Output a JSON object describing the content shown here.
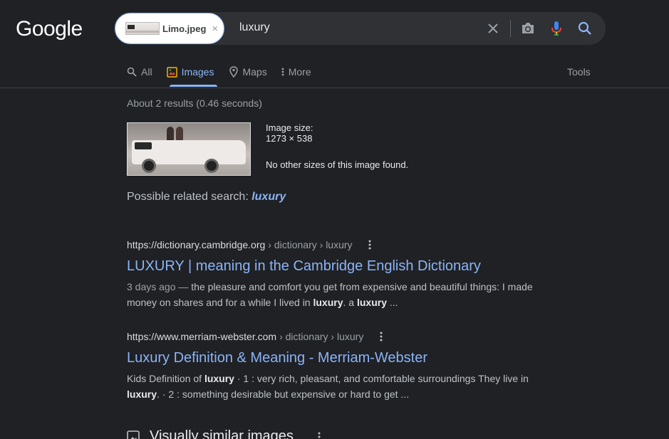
{
  "header": {
    "logo": "Google",
    "chip_label": "Limo.jpeg",
    "chip_close": "×",
    "query": "luxury"
  },
  "tabs": [
    {
      "label": "All",
      "icon": "search-icon"
    },
    {
      "label": "Images",
      "icon": "image-icon",
      "active": true
    },
    {
      "label": "Maps",
      "icon": "map-pin-icon"
    },
    {
      "label": "More",
      "icon": "more-vert-icon"
    }
  ],
  "tools_label": "Tools",
  "stats": "About 2 results (0.46 seconds)",
  "image_info": {
    "size_label": "Image size:",
    "size_value": "1273 × 538",
    "no_other": "No other sizes of this image found."
  },
  "related": {
    "prefix": "Possible related search: ",
    "term": "luxury"
  },
  "results": [
    {
      "url": "https://dictionary.cambridge.org",
      "crumb": "› dictionary › luxury",
      "title": "LUXURY | meaning in the Cambridge English Dictionary",
      "date": "3 days ago —",
      "snippet_a": " the pleasure and comfort you get from expensive and beautiful things: I made money on shares and for a while I lived in ",
      "bold_a": "luxury",
      "snippet_b": ". a ",
      "bold_b": "luxury",
      "snippet_c": " ..."
    },
    {
      "url": "https://www.merriam-webster.com",
      "crumb": "› dictionary › luxury",
      "title": "Luxury Definition & Meaning - Merriam-Webster",
      "snippet_a": "Kids Definition of ",
      "bold_a": "luxury",
      "snippet_b": " · 1 : very rich, pleasant, and comfortable surroundings They live in ",
      "bold_b": "luxury",
      "snippet_c": ". · 2 : something desirable but expensive or hard to get ..."
    }
  ],
  "visually_similar": "Visually similar images",
  "colors": {
    "background": "#202124",
    "link": "#8ab4f8",
    "text": "#bdc1c6"
  }
}
